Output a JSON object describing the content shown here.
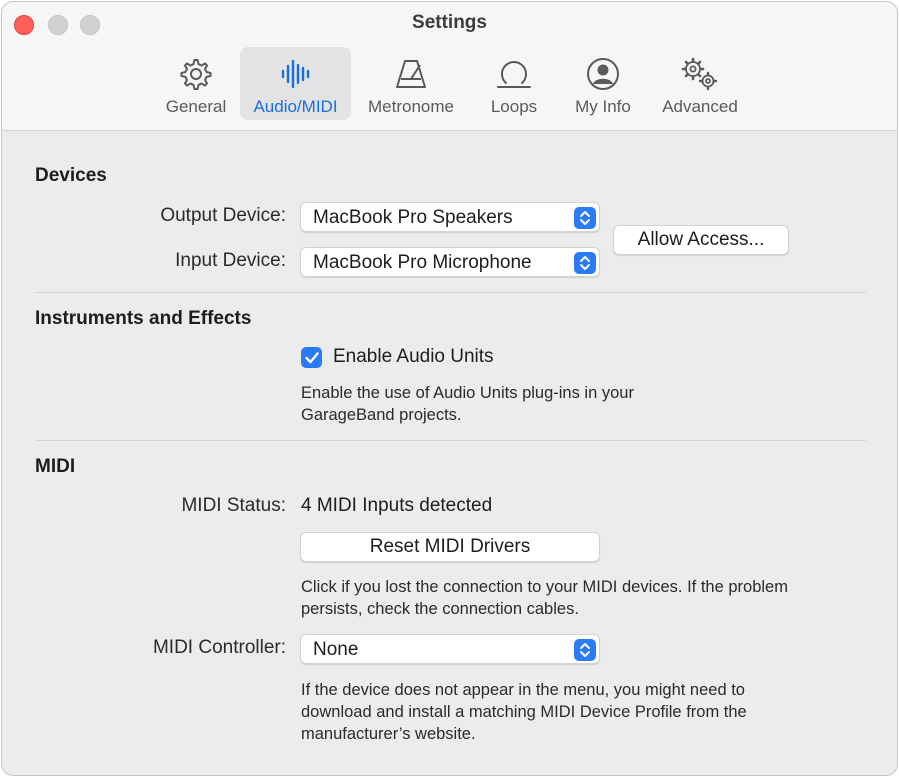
{
  "window": {
    "title": "Settings"
  },
  "tabs": [
    {
      "label": "General",
      "icon": "gear-icon"
    },
    {
      "label": "Audio/MIDI",
      "icon": "waveform-icon",
      "active": true
    },
    {
      "label": "Metronome",
      "icon": "metronome-icon"
    },
    {
      "label": "Loops",
      "icon": "loop-icon"
    },
    {
      "label": "My Info",
      "icon": "person-icon"
    },
    {
      "label": "Advanced",
      "icon": "gears-icon"
    }
  ],
  "devices": {
    "heading": "Devices",
    "output_label": "Output Device:",
    "output_value": "MacBook Pro Speakers",
    "input_label": "Input Device:",
    "input_value": "MacBook Pro Microphone",
    "allow_access": "Allow Access..."
  },
  "instruments": {
    "heading": "Instruments and Effects",
    "checkbox_label": "Enable Audio Units",
    "checked": true,
    "description_line1": "Enable the use of Audio Units plug-ins in your",
    "description_line2": "GarageBand projects."
  },
  "midi": {
    "heading": "MIDI",
    "status_label": "MIDI Status:",
    "status_value": "4 MIDI Inputs detected",
    "reset_button": "Reset MIDI Drivers",
    "reset_desc_line1": "Click if you lost the connection to your MIDI devices. If the problem",
    "reset_desc_line2": "persists, check the connection cables.",
    "controller_label": "MIDI Controller:",
    "controller_value": "None",
    "controller_desc_line1": "If the device does not appear in the menu, you might need to",
    "controller_desc_line2": "download and install a matching MIDI Device Profile from the",
    "controller_desc_line3": "manufacturer’s website."
  },
  "colors": {
    "accent": "#2a7bf6",
    "active_tab_text": "#1a6fe0",
    "close_button": "#ff5f57"
  }
}
